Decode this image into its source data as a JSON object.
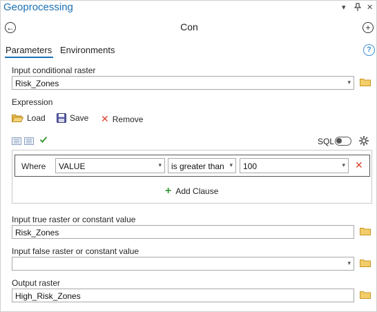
{
  "pane": {
    "title": "Geoprocessing"
  },
  "tool": {
    "title": "Con"
  },
  "tabs": [
    {
      "label": "Parameters"
    },
    {
      "label": "Environments"
    }
  ],
  "params": {
    "input_conditional_raster": {
      "label": "Input conditional raster",
      "value": "Risk_Zones"
    },
    "expression": {
      "label": "Expression",
      "load_label": "Load",
      "save_label": "Save",
      "remove_label": "Remove",
      "sql_label": "SQL",
      "clause": {
        "where_label": "Where",
        "field": "VALUE",
        "operator": "is greater than",
        "value": "100"
      },
      "add_clause_label": "Add Clause"
    },
    "input_true": {
      "label": "Input true raster or constant value",
      "value": "Risk_Zones"
    },
    "input_false": {
      "label": "Input false raster or constant value",
      "value": ""
    },
    "output_raster": {
      "label": "Output raster",
      "value": "High_Risk_Zones"
    }
  },
  "colors": {
    "accent": "#1a6fb5",
    "folder": "#e8b84a",
    "remove_red": "#d9432f",
    "check_green": "#3a9a3a"
  }
}
